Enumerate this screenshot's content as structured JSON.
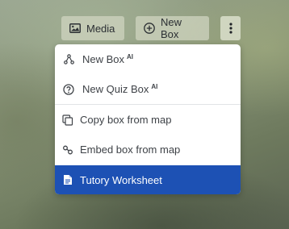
{
  "toolbar": {
    "media_label": "Media",
    "new_box_label": "New Box"
  },
  "menu": {
    "items": [
      {
        "label": "New Box",
        "badge": "AI",
        "icon": "ai-nodes-icon"
      },
      {
        "label": "New Quiz Box",
        "badge": "AI",
        "icon": "question-circle-icon"
      },
      {
        "label": "Copy box from map",
        "icon": "copy-icon"
      },
      {
        "label": "Embed box from map",
        "icon": "link-icon"
      },
      {
        "label": "Tutory Worksheet",
        "icon": "document-icon",
        "active": true
      }
    ]
  },
  "colors": {
    "menu_active_bg": "#1d51b4",
    "menu_text": "#3e4247",
    "toolbar_button_bg": "#cdd2be"
  }
}
